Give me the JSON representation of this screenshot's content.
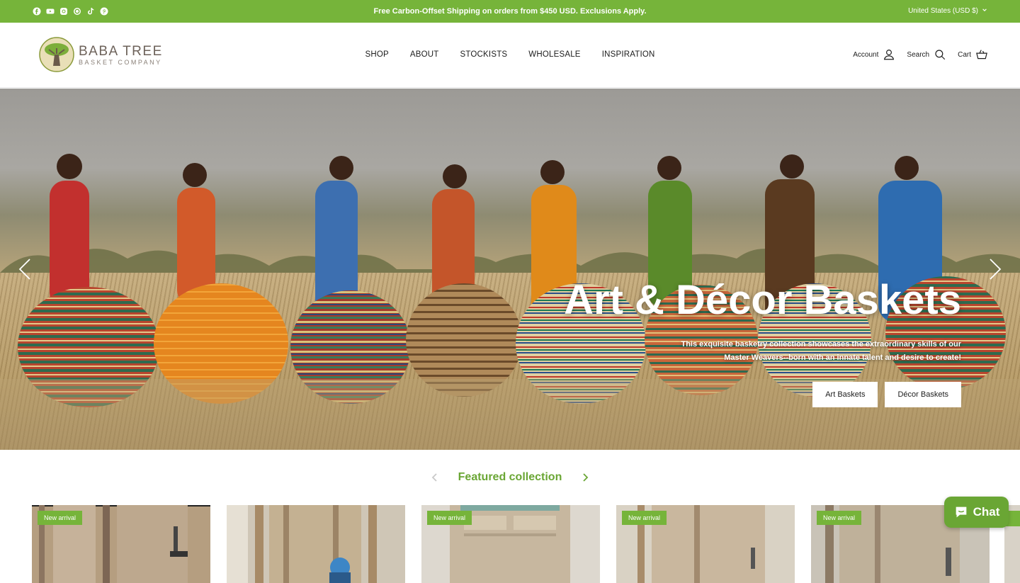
{
  "announcement": {
    "text": "Free Carbon-Offset Shipping on orders from $450 USD. Exclusions Apply.",
    "currency": "United States (USD $)",
    "social_icons": [
      "facebook-icon",
      "youtube-icon",
      "instagram-icon",
      "whatsapp-icon",
      "tiktok-icon",
      "pinterest-icon"
    ]
  },
  "header": {
    "logo_title": "BABA TREE",
    "logo_subtitle": "BASKET COMPANY",
    "nav": [
      "SHOP",
      "ABOUT",
      "STOCKISTS",
      "WHOLESALE",
      "INSPIRATION"
    ],
    "account_label": "Account",
    "search_label": "Search",
    "cart_label": "Cart"
  },
  "hero": {
    "title": "Art & Décor Baskets",
    "subtitle_line1": "This exquisite basketry collection showcases the extraordinary skills of our",
    "subtitle_line2": "Master Weavers--born with an innate talent and desire to create!",
    "buttons": [
      "Art Baskets",
      "Décor Baskets"
    ]
  },
  "featured": {
    "title": "Featured collection",
    "badge": "New arrival",
    "cards": [
      {
        "badge": "New arrival"
      },
      {
        "badge": ""
      },
      {
        "badge": "New arrival"
      },
      {
        "badge": "New arrival"
      },
      {
        "badge": "New arrival"
      }
    ]
  },
  "chat": {
    "label": "Chat"
  },
  "colors": {
    "brand_green": "#76b43a",
    "title_green": "#6aa634"
  }
}
